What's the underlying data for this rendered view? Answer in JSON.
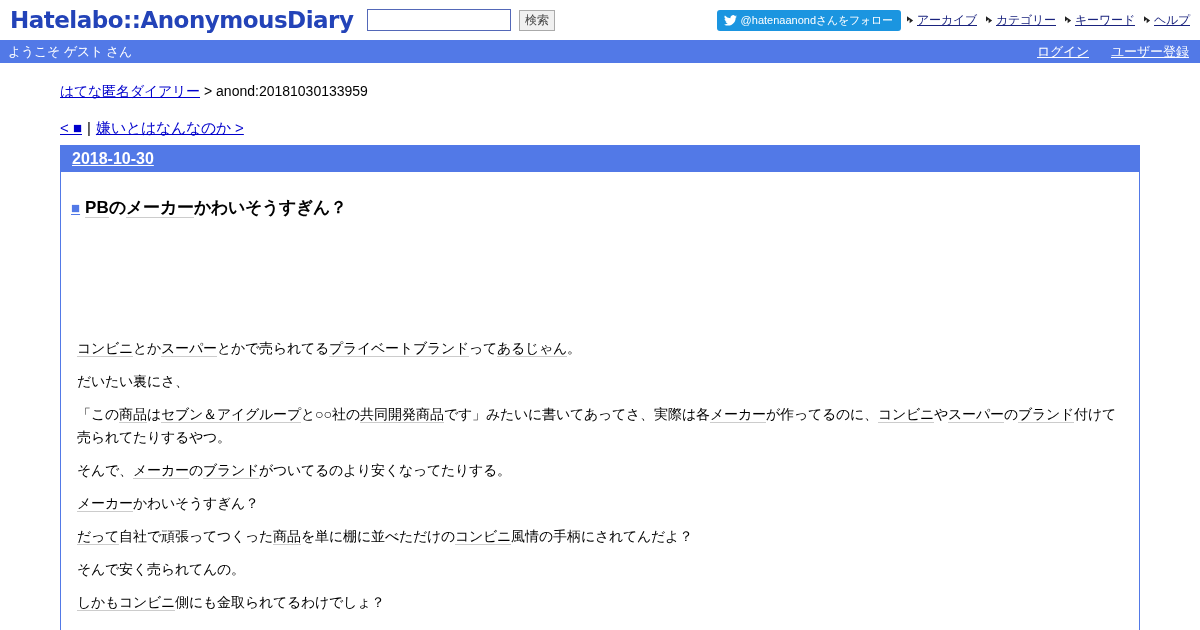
{
  "header": {
    "logo": "Hatelabo::AnonymousDiary",
    "search": {
      "button": "検索"
    },
    "follow_button": "@hatenaanondさんをフォロー",
    "nav": [
      "アーカイブ",
      "カテゴリー",
      "キーワード",
      "ヘルプ"
    ]
  },
  "user_bar": {
    "welcome": "ようこそ ゲスト さん",
    "links": [
      "ログイン",
      "ユーザー登録"
    ]
  },
  "breadcrumb": {
    "link": "はてな匿名ダイアリー",
    "current": "> anond:20181030133959"
  },
  "pager": {
    "prev": "< ■",
    "separator": "|",
    "next": "嫌いとはなんなのか >"
  },
  "day": {
    "date": "2018-10-30",
    "title": {
      "mark": "■",
      "segments": [
        {
          "kind": "keyword",
          "text": "PB"
        },
        {
          "kind": "plain",
          "text": "の"
        },
        {
          "kind": "keyword",
          "text": "メーカー"
        },
        {
          "kind": "plain",
          "text": "かわいそうすぎん？"
        }
      ]
    },
    "paragraphs": [
      [
        {
          "kind": "keyword",
          "text": "コンビニ"
        },
        {
          "kind": "plain",
          "text": "とか"
        },
        {
          "kind": "keyword",
          "text": "スーパー"
        },
        {
          "kind": "plain",
          "text": "とかで売られてる"
        },
        {
          "kind": "keyword",
          "text": "プライベートブランド"
        },
        {
          "kind": "plain",
          "text": "って"
        },
        {
          "kind": "keyword",
          "text": "あるじゃん"
        },
        {
          "kind": "plain",
          "text": "。"
        }
      ],
      [
        {
          "kind": "plain",
          "text": "だいたい裏にさ、"
        }
      ],
      [
        {
          "kind": "plain",
          "text": "「この"
        },
        {
          "kind": "keyword",
          "text": "商品"
        },
        {
          "kind": "plain",
          "text": "は"
        },
        {
          "kind": "keyword",
          "text": "セブン＆アイグループ"
        },
        {
          "kind": "plain",
          "text": "と○○社の"
        },
        {
          "kind": "keyword",
          "text": "共同開発商品"
        },
        {
          "kind": "plain",
          "text": "です」みたいに書いてあってさ、実際は各"
        },
        {
          "kind": "keyword",
          "text": "メーカー"
        },
        {
          "kind": "plain",
          "text": "が作ってるのに、"
        },
        {
          "kind": "keyword",
          "text": "コンビニ"
        },
        {
          "kind": "plain",
          "text": "や"
        },
        {
          "kind": "keyword",
          "text": "スーパー"
        },
        {
          "kind": "plain",
          "text": "の"
        },
        {
          "kind": "keyword",
          "text": "ブランド"
        },
        {
          "kind": "plain",
          "text": "付けて売られてたりするやつ。"
        }
      ],
      [
        {
          "kind": "plain",
          "text": "そんで、"
        },
        {
          "kind": "keyword",
          "text": "メーカー"
        },
        {
          "kind": "plain",
          "text": "の"
        },
        {
          "kind": "keyword",
          "text": "ブランド"
        },
        {
          "kind": "plain",
          "text": "がついてるのより安くなってたりする。"
        }
      ],
      [
        {
          "kind": "keyword",
          "text": "メーカー"
        },
        {
          "kind": "plain",
          "text": "かわいそうすぎん？"
        }
      ],
      [
        {
          "kind": "keyword",
          "text": "だって"
        },
        {
          "kind": "plain",
          "text": "自社で頑張ってつくった"
        },
        {
          "kind": "keyword",
          "text": "商品"
        },
        {
          "kind": "plain",
          "text": "を単に棚に並べただけの"
        },
        {
          "kind": "keyword",
          "text": "コンビニ"
        },
        {
          "kind": "plain",
          "text": "風情の手柄にされてんだよ？"
        }
      ],
      [
        {
          "kind": "plain",
          "text": "そんで安く売られてんの。"
        }
      ],
      [
        {
          "kind": "keyword",
          "text": "しかも"
        },
        {
          "kind": "keyword",
          "text": "コンビニ"
        },
        {
          "kind": "plain",
          "text": "側にも金取られてるわけでしょ？"
        }
      ]
    ]
  }
}
